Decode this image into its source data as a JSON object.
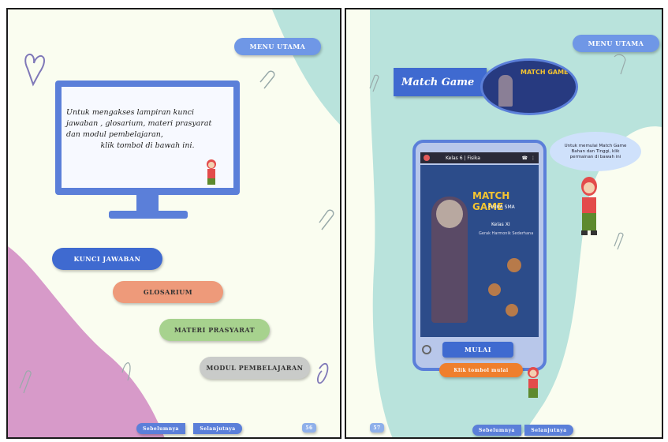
{
  "left": {
    "menu_button": "MENU UTAMA",
    "instruction_lines": [
      "Untuk mengakses lampiran kunci",
      "jawaban , glosarium, materi prasyarat",
      "dan modul pembelajaran,",
      "klik tombol di bawah ini."
    ],
    "buttons": [
      "KUNCI JAWABAN",
      "GLOSARIUM",
      "MATERI PRASYARAT",
      "MODUL PEMBELAJARAN"
    ],
    "nav_prev": "Sebelumnya",
    "nav_next": "Selanjutnya",
    "page_number": "56"
  },
  "right": {
    "menu_button": "MENU UTAMA",
    "title": "Match Game",
    "speech_bubble": "Untuk memulai Match Game Bahan dan Tinggi, klik permainan di bawah ini",
    "phone_header": "Kelas 6 | Fisika",
    "game_title": "MATCH GAME",
    "game_subtitle": "FISIKA SMA",
    "game_level": "Kelas XI",
    "game_desc": "Gerak Harmonik Sederhana",
    "play_button": "MULAI",
    "play_prompt": "Klik tombol mulai",
    "nav_prev": "Sebelumnya",
    "nav_next": "Selanjutnya",
    "page_number": "57"
  },
  "colors": {
    "blue_button": "#3f6ad0",
    "salmon_button": "#ee9a7a",
    "green_button": "#a7d28e",
    "gray_button": "#c9cbc9",
    "teal_blob": "#b9e3dc",
    "pink_blob": "#d79ac9",
    "monitor_frame": "#5b7fd9",
    "orange_button": "#ef7f2d"
  },
  "icons": [
    "heart-doodle-icon",
    "paperclip-icon",
    "user-icon",
    "phone-icon",
    "menu-dots-icon",
    "character-icon"
  ]
}
